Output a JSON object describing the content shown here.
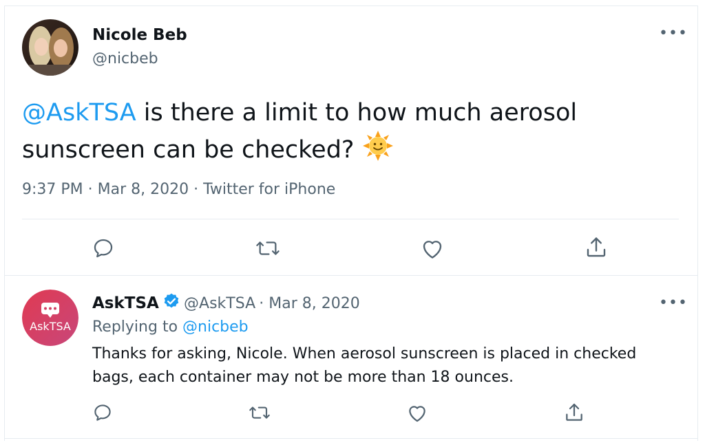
{
  "tweet": {
    "author_name": "Nicole Beb",
    "author_handle": "@nicbeb",
    "mention": "@AskTSA",
    "text_line1": " is there a limit to how much aerosol",
    "text_line2": "sunscreen can be checked? ",
    "emoji": "🌞",
    "meta": "9:37 PM · Mar 8, 2020 · Twitter for iPhone",
    "more_label": "•••",
    "actions": [
      "reply-icon",
      "retweet-icon",
      "like-icon",
      "share-icon"
    ]
  },
  "reply": {
    "author_name": "AskTSA",
    "author_handle": "@AskTSA",
    "date": "· Mar 8, 2020",
    "avatar_label": "AskTSA",
    "replying_prefix": "Replying to ",
    "replying_to": "@nicbeb",
    "text_line1": "Thanks for asking, Nicole. When aerosol sunscreen is placed in checked",
    "text_line2": "bags, each container may not be more than 18 ounces.",
    "more_label": "•••",
    "actions": [
      "reply-icon",
      "retweet-icon",
      "like-icon",
      "share-icon"
    ]
  },
  "colors": {
    "accent": "#1d9bf0",
    "muted": "#536471",
    "text": "#0f1419",
    "border": "#e6ecf0"
  }
}
